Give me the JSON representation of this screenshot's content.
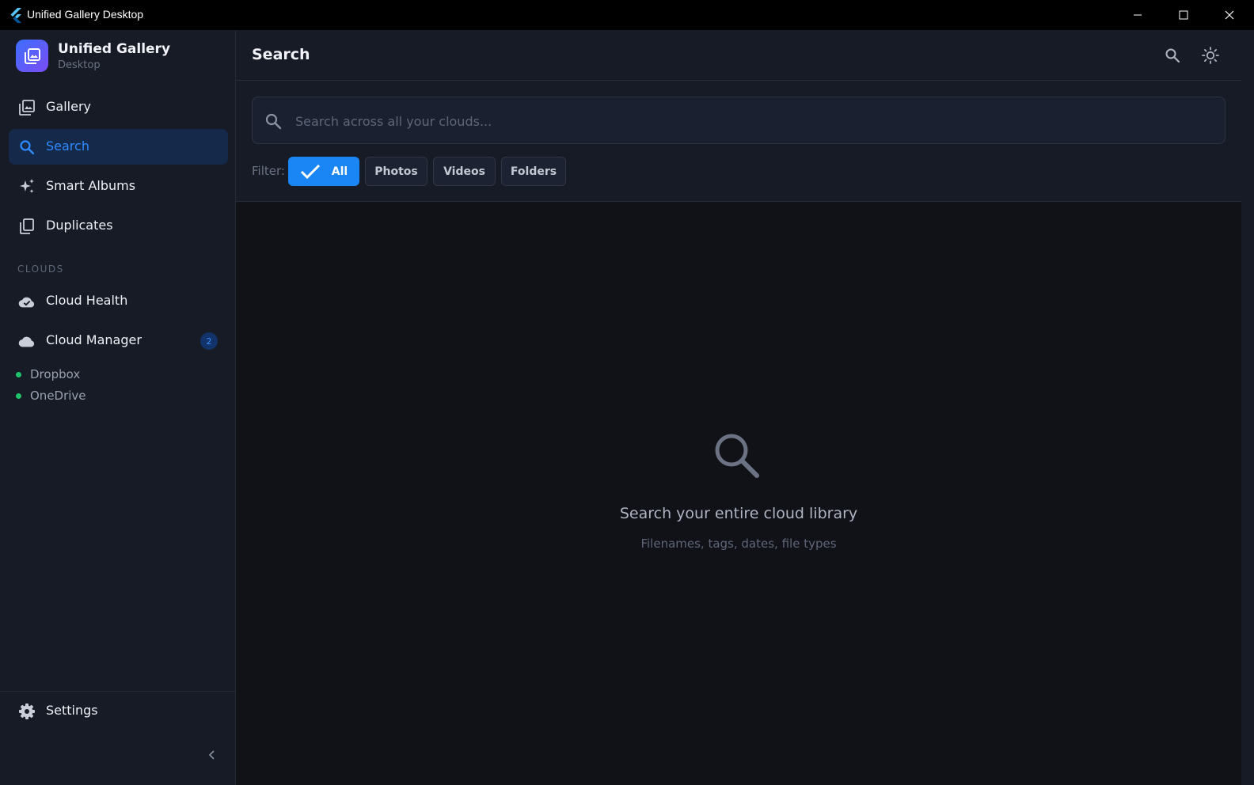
{
  "window": {
    "title": "Unified Gallery Desktop",
    "controls": [
      "minimize-icon",
      "maximize-icon",
      "close-icon"
    ]
  },
  "brand": {
    "name": "Unified Gallery",
    "subtitle": "Desktop",
    "gradient": [
      "#3d6fff",
      "#7b4cf5"
    ]
  },
  "sidebar": {
    "nav": [
      {
        "label": "Gallery",
        "icon": "gallery-icon",
        "active": false
      },
      {
        "label": "Search",
        "icon": "search-icon",
        "active": true
      },
      {
        "label": "Smart Albums",
        "icon": "sparkles-icon",
        "active": false
      },
      {
        "label": "Duplicates",
        "icon": "duplicates-icon",
        "active": false
      }
    ],
    "section_label": "CLOUDS",
    "clouds": [
      {
        "label": "Cloud Health",
        "icon": "cloud-check-icon"
      },
      {
        "label": "Cloud Manager",
        "icon": "cloud-icon",
        "badge": "2"
      }
    ],
    "connected": [
      {
        "label": "Dropbox",
        "status": "connected"
      },
      {
        "label": "OneDrive",
        "status": "connected"
      }
    ],
    "settings_label": "Settings",
    "settings_icon": "gear-icon",
    "collapse_icon": "chevron-left-icon"
  },
  "header": {
    "title": "Search",
    "icons": [
      "search-icon",
      "sun-icon"
    ]
  },
  "search": {
    "placeholder": "Search across all your clouds...",
    "value": ""
  },
  "filter": {
    "label": "Filter:",
    "options": [
      {
        "label": "All",
        "selected": true
      },
      {
        "label": "Photos",
        "selected": false
      },
      {
        "label": "Videos",
        "selected": false
      },
      {
        "label": "Folders",
        "selected": false
      }
    ]
  },
  "empty_state": {
    "icon": "search-icon",
    "title": "Search your entire cloud library",
    "subtitle": "Filenames, tags, dates, file types"
  },
  "colors": {
    "accent": "#1a86f5",
    "active_nav_bg": "#15294a",
    "status_connected": "#1fc36a",
    "sidebar_bg": "#161b26",
    "content_bg": "#111217"
  }
}
